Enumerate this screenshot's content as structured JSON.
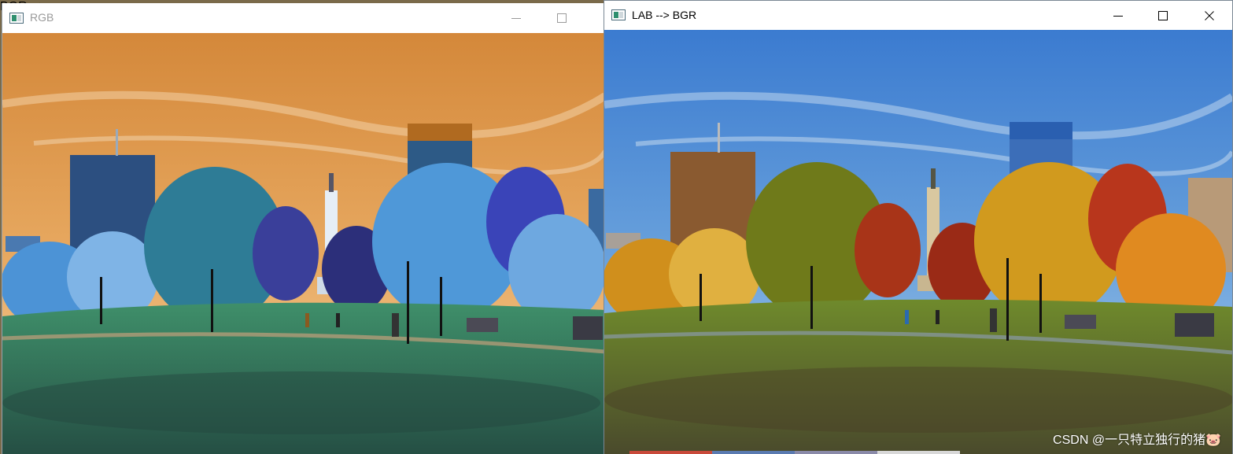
{
  "windows": {
    "left": {
      "title": "RGB",
      "controls": [
        "minimize-button",
        "maximize-button"
      ],
      "palette": {
        "sky_top": "#d4883a",
        "sky_bottom": "#f0c58a",
        "tree": "#3d7fc4",
        "tree_dark": "#2b5f8f",
        "grass": "#2f7a5e",
        "building": "#2c4f80"
      }
    },
    "right": {
      "title": "LAB --> BGR",
      "controls": [
        "minimize-button",
        "maximize-button",
        "close-button"
      ],
      "palette": {
        "sky_top": "#3b7bd0",
        "sky_bottom": "#a8c8e8",
        "tree": "#c98a1f",
        "tree_dark": "#7a5a18",
        "grass": "#5f7a2a",
        "building": "#8a5a30"
      }
    }
  },
  "watermark": "CSDN @一只特立独行的猪🐷"
}
